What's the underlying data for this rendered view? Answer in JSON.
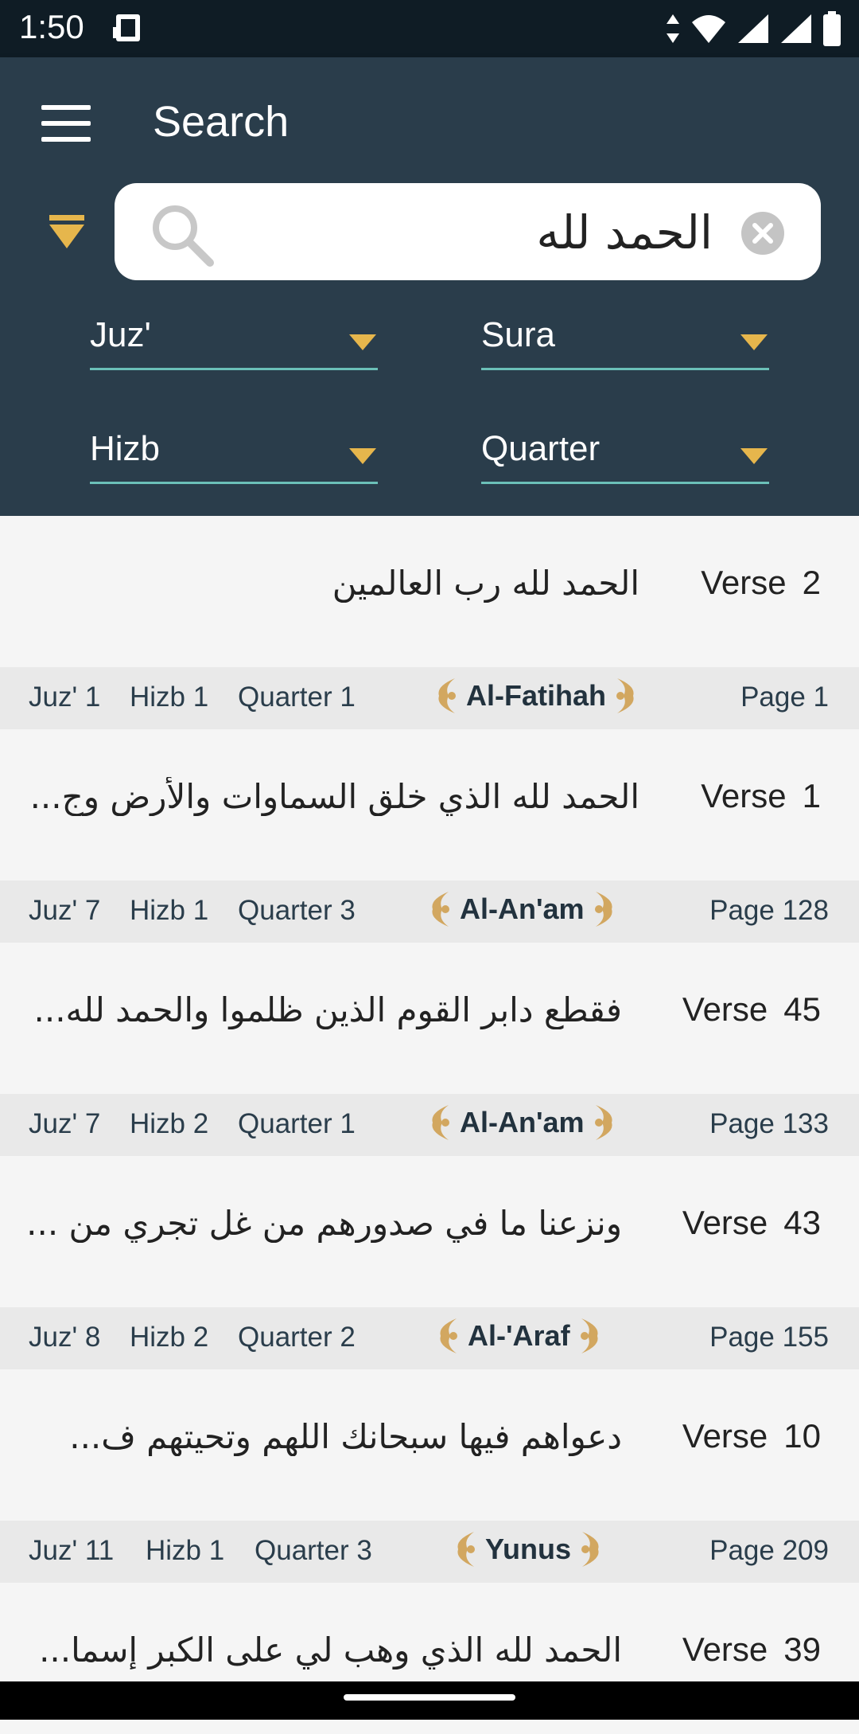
{
  "status_bar": {
    "time": "1:50"
  },
  "app_bar": {
    "title": "Search"
  },
  "search": {
    "value": "الحمد لله"
  },
  "filters": {
    "juz_label": "Juz'",
    "sura_label": "Sura",
    "hizb_label": "Hizb",
    "quarter_label": "Quarter"
  },
  "colors": {
    "app_bar": "#2a3d4b",
    "accent": "#e6b64c",
    "underline": "#6bc0b8"
  },
  "results": [
    {
      "verse_label": "Verse",
      "verse_number": "2",
      "text": "الحمد لله رب العالمين",
      "juz": "Juz' 1",
      "hizb": "Hizb 1",
      "quarter": "Quarter 1",
      "sura": "Al-Fatihah",
      "page": "Page 1"
    },
    {
      "verse_label": "Verse",
      "verse_number": "1",
      "text": "الحمد لله الذي خلق السماوات والأرض وج...",
      "juz": "Juz' 7",
      "hizb": "Hizb 1",
      "quarter": "Quarter 3",
      "sura": "Al-An'am",
      "page": "Page 128"
    },
    {
      "verse_label": "Verse",
      "verse_number": "45",
      "text": "فقطع دابر القوم الذين ظلموا والحمد لله...",
      "juz": "Juz' 7",
      "hizb": "Hizb 2",
      "quarter": "Quarter 1",
      "sura": "Al-An'am",
      "page": "Page 133"
    },
    {
      "verse_label": "Verse",
      "verse_number": "43",
      "text": "ونزعنا ما في صدورهم من غل تجري من ...",
      "juz": "Juz' 8",
      "hizb": "Hizb 2",
      "quarter": "Quarter 2",
      "sura": "Al-'Araf",
      "page": "Page 155"
    },
    {
      "verse_label": "Verse",
      "verse_number": "10",
      "text": "دعواهم فيها سبحانك اللهم وتحيتهم ف...",
      "juz": "Juz' 11",
      "hizb": "Hizb 1",
      "quarter": "Quarter 3",
      "sura": "Yunus",
      "page": "Page 209"
    },
    {
      "verse_label": "Verse",
      "verse_number": "39",
      "text": "الحمد لله الذي وهب لي على الكبر إسما..."
    }
  ]
}
